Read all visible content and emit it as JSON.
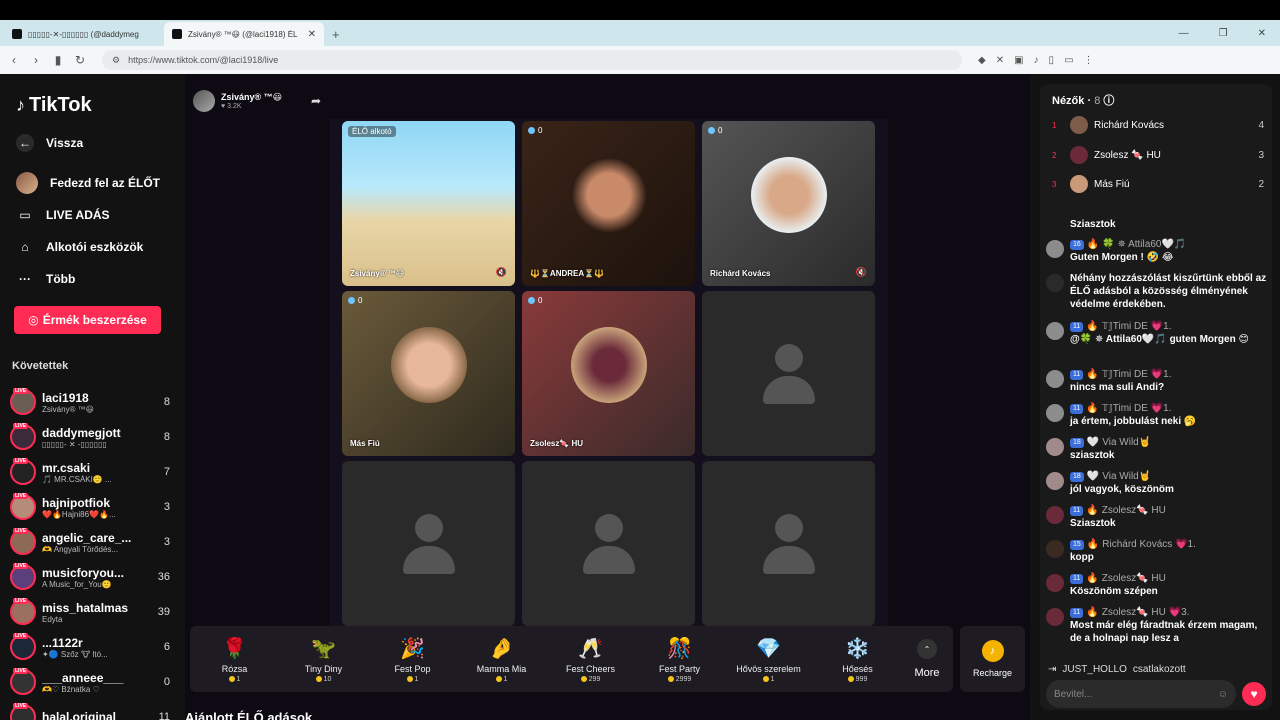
{
  "browser": {
    "tabs": [
      {
        "title": "▯▯▯▯▯-✕-▯▯▯▯▯▯ (@daddymeg",
        "active": false
      },
      {
        "title": "Zsivány® ™😃 (@laci1918) ÉL",
        "active": true
      }
    ],
    "new_tab": "+",
    "url": "https://www.tiktok.com/@laci1918/live"
  },
  "sidebar": {
    "logo": "TikTok",
    "back": "Vissza",
    "explore": "Fedezd fel az ÉLŐT",
    "live_studio": "LIVE ADÁS",
    "creator_tools": "Alkotói eszközök",
    "more": "Több",
    "coins_button": "Érmék beszerzése",
    "following_title": "Követettek",
    "following": [
      {
        "name": "laci1918",
        "sub": "Zsivány® ™😃",
        "count": "8"
      },
      {
        "name": "daddymegjott",
        "sub": "▯▯▯▯▯- ✕ -▯▯▯▯▯▯",
        "count": "8"
      },
      {
        "name": "mr.csaki",
        "sub": "🎵 MR.CSÁKI🙂 ...",
        "count": "7"
      },
      {
        "name": "hajnipotfiok",
        "sub": "❤️🔥Hajni86❤️🔥...",
        "count": "3"
      },
      {
        "name": "angelic_care_...",
        "sub": "🫶 Angyali Törődés...",
        "count": "3"
      },
      {
        "name": "musicforyou...",
        "sub": "A Music_for_You🙂",
        "count": "36"
      },
      {
        "name": "miss_hatalmas",
        "sub": "Edyta",
        "count": "39"
      },
      {
        "name": "...1122r",
        "sub": "✦🔵 Szőz 🐮 ltó...",
        "count": "6"
      },
      {
        "name": "___anneee___",
        "sub": "🫶♡ Bźnatka ♡",
        "count": "0"
      },
      {
        "name": "halal.original",
        "sub": "",
        "count": "11"
      }
    ]
  },
  "stream": {
    "host_name": "Zsivány® ™😃",
    "host_likes": "3.2K",
    "tiles": [
      {
        "label": "ÉLŐ alkotó",
        "name": "Zsivány® ™😃",
        "type": "beach"
      },
      {
        "label": "0",
        "name": "🔱⏳ANDREA⏳🔱",
        "type": "face"
      },
      {
        "label": "0",
        "name": "Richárd Kovács",
        "type": "face"
      },
      {
        "label": "0",
        "name": "Más Fiú",
        "type": "face"
      },
      {
        "label": "0",
        "name": "Zsolesz🍬 HU",
        "type": "face"
      },
      {
        "label": "",
        "name": "",
        "type": "empty"
      },
      {
        "label": "",
        "name": "",
        "type": "empty"
      },
      {
        "label": "",
        "name": "",
        "type": "empty"
      },
      {
        "label": "",
        "name": "",
        "type": "empty"
      }
    ],
    "gifts": [
      {
        "name": "Rózsa",
        "price": "1",
        "icon": "🌹"
      },
      {
        "name": "Tiny Diny",
        "price": "10",
        "icon": "🦖"
      },
      {
        "name": "Fest Pop",
        "price": "1",
        "icon": "🎉"
      },
      {
        "name": "Mamma Mia",
        "price": "1",
        "icon": "🤌"
      },
      {
        "name": "Fest Cheers",
        "price": "299",
        "icon": "🥂"
      },
      {
        "name": "Fest Party",
        "price": "2999",
        "icon": "🎊"
      },
      {
        "name": "Hővös szerelem",
        "price": "1",
        "icon": "💎"
      },
      {
        "name": "Hőesés",
        "price": "999",
        "icon": "❄️"
      }
    ],
    "more_label": "More",
    "recharge_label": "Recharge",
    "recommended_title": "Ajánlott ÉLŐ adások"
  },
  "panel": {
    "viewers_title": "Nézők",
    "viewers_count": "8",
    "viewers": [
      {
        "rank": "1",
        "name": "Richárd Kovács",
        "score": "4"
      },
      {
        "rank": "2",
        "name": "Zsolesz 🍬 HU",
        "score": "3"
      },
      {
        "rank": "3",
        "name": "Más Fiú",
        "score": "2"
      }
    ],
    "messages": [
      {
        "name": "",
        "badges": [],
        "text": "Sziasztok"
      },
      {
        "name": "🍀 ✵ Attila60🤍🎵",
        "badges": [
          "16",
          "🔥"
        ],
        "text": "Guten Morgen ! 🤣 😂"
      },
      {
        "name": "",
        "badges": [],
        "text": "Néhány hozzászólást kiszűrtünk ebből az ÉLŐ adásból a közösség élményének védelme érdekében."
      },
      {
        "name": "𝕋𝕁Timi DE 💗1.",
        "badges": [
          "11",
          "🔥"
        ],
        "text": "@🍀 ✵ Attila60🤍🎵 guten Morgen 😊"
      },
      {
        "name": "𝕋𝕁Timi DE 💗1.",
        "badges": [
          "11",
          "🔥"
        ],
        "text": "nincs ma suli Andi?"
      },
      {
        "name": "𝕋𝕁Timi DE 💗1.",
        "badges": [
          "11",
          "🔥"
        ],
        "text": "ja értem, jobbulást neki 🥱"
      },
      {
        "name": "Via Wild🤘",
        "badges": [
          "18",
          "🤍"
        ],
        "text": "sziasztok"
      },
      {
        "name": "Via Wild🤘",
        "badges": [
          "18",
          "🤍"
        ],
        "text": "jól vagyok, köszönöm"
      },
      {
        "name": "Zsolesz🍬 HU",
        "badges": [
          "11",
          "🔥"
        ],
        "text": "Sziasztok"
      },
      {
        "name": "Richárd Kovács 💗1.",
        "badges": [
          "15",
          "🔥"
        ],
        "text": "kopp"
      },
      {
        "name": "Zsolesz🍬 HU",
        "badges": [
          "11",
          "🔥"
        ],
        "text": "Köszönöm szépen"
      },
      {
        "name": "Zsolesz🍬 HU 💗3.",
        "badges": [
          "11",
          "🔥"
        ],
        "text": "Most már elég fáradtnak érzem magam, de a holnapi nap lesz a"
      }
    ],
    "join_user": "JUST_HOLLO",
    "join_text": "csatlakozott",
    "input_placeholder": "Bevitel..."
  }
}
